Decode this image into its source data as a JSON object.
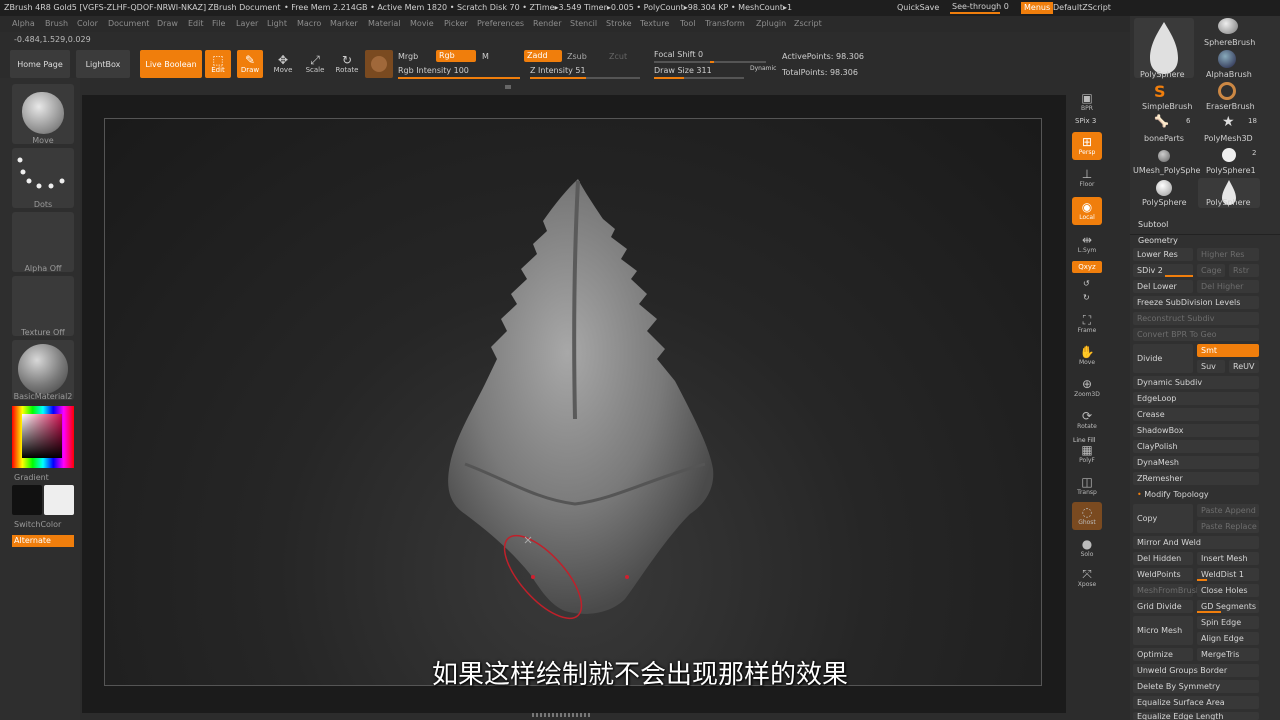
{
  "title": {
    "app": "ZBrush 4R8 Gold5 [VGFS-ZLHF-QDOF-NRWI-NKAZ]",
    "doc": "ZBrush Document",
    "stats": "• Free Mem 2.214GB • Active Mem 1820 • Scratch Disk 70 • ZTime▸3.549 Timer▸0.005 • PolyCount▸98.304 KP • MeshCount▸1",
    "quicksave": "QuickSave",
    "seethrough": "See-through 0",
    "menus": "Menus",
    "script": "DefaultZScript"
  },
  "menubar": [
    "Alpha",
    "Brush",
    "Color",
    "Document",
    "Draw",
    "Edit",
    "File",
    "Layer",
    "Light",
    "Macro",
    "Marker",
    "Material",
    "Movie",
    "Picker",
    "Preferences",
    "Render",
    "Stencil",
    "Stroke",
    "Texture",
    "Tool",
    "Transform",
    "Zplugin",
    "Zscript"
  ],
  "coords": "-0.484,1.529,0.029",
  "toolbar": {
    "home": "Home Page",
    "lightbox": "LightBox",
    "liveboolean": "Live Boolean",
    "edit": "Edit",
    "draw": "Draw",
    "move": "Move",
    "scale": "Scale",
    "rotate": "Rotate",
    "mrgb": "Mrgb",
    "rgb": "Rgb",
    "m": "M",
    "rgb_intensity": "Rgb Intensity 100",
    "zadd": "Zadd",
    "zsub": "Zsub",
    "zcut": "Zcut",
    "z_intensity": "Z Intensity 51",
    "focal_shift": "Focal Shift 0",
    "draw_size": "Draw Size 311",
    "dynamic": "Dynamic",
    "active_points": "ActivePoints: 98.306",
    "total_points": "TotalPoints: 98.306"
  },
  "left": {
    "brush": "Move",
    "stroke": "Dots",
    "alpha": "Alpha Off",
    "texture": "Texture Off",
    "material": "BasicMaterial2",
    "gradient": "Gradient",
    "switch": "SwitchColor",
    "alternate": "Alternate"
  },
  "rightshelf": [
    "BPR",
    "SPix 3",
    "Persp",
    "Floor",
    "Local",
    "L.Sym",
    "Qxyz",
    "Frame",
    "Move",
    "Zoom3D",
    "Rotate",
    "PolyF",
    "Transp",
    "Ghost",
    "Solo",
    "Xpose"
  ],
  "line_fill": "Line Fill",
  "tools": [
    {
      "name": "PolySphere",
      "n": ""
    },
    {
      "name": "SphereBrush",
      "n": ""
    },
    {
      "name": "AlphaBrush",
      "n": ""
    },
    {
      "name": "SimpleBrush",
      "n": ""
    },
    {
      "name": "EraserBrush",
      "n": ""
    },
    {
      "name": "boneParts",
      "n": "6"
    },
    {
      "name": "PolyMesh3D",
      "n": "18"
    },
    {
      "name": "UMesh_PolySphe",
      "n": ""
    },
    {
      "name": "PolySphere1",
      "n": "2"
    },
    {
      "name": "PolySphere",
      "n": ""
    },
    {
      "name": "PolySphere",
      "n": ""
    }
  ],
  "panel": {
    "subtool": "Subtool",
    "geometry": "Geometry",
    "lower_res": "Lower Res",
    "higher_res": "Higher Res",
    "sdiv": "SDiv 2",
    "cage": "Cage",
    "rstr": "Rstr",
    "del_lower": "Del Lower",
    "del_higher": "Del Higher",
    "freeze": "Freeze SubDivision Levels",
    "reconstruct": "Reconstruct Subdiv",
    "convert": "Convert BPR To Geo",
    "divide": "Divide",
    "smt": "Smt",
    "suv": "Suv",
    "reuv": "ReUV",
    "dynamic_subdiv": "Dynamic Subdiv",
    "edgeloop": "EdgeLoop",
    "crease": "Crease",
    "shadowbox": "ShadowBox",
    "claypolish": "ClayPolish",
    "dynamesh": "DynaMesh",
    "zremesher": "ZRemesher",
    "modify_topology": "Modify Topology",
    "copy": "Copy",
    "paste_append": "Paste Append",
    "paste_replace": "Paste Replace",
    "mirror_weld": "Mirror And Weld",
    "del_hidden": "Del Hidden",
    "insert_mesh": "Insert Mesh",
    "weld_points": "WeldPoints",
    "welddist": "WeldDist 1",
    "mesh_from_brush": "MeshFromBrush",
    "close_holes": "Close Holes",
    "grid_divide": "Grid Divide",
    "gd_segments": "GD Segments 3",
    "spin_edge": "Spin Edge",
    "align_edge": "Align Edge",
    "micro_mesh": "Micro Mesh",
    "optimize_points": "Optimize Points",
    "merge_tris": "MergeTris",
    "unweld_groups": "Unweld Groups Border",
    "delete_symmetry": "Delete By Symmetry",
    "equalize_area": "Equalize Surface Area",
    "equalize_edge": "Equalize Edge Length"
  },
  "subtitle": "如果这样绘制就不会出现那样的效果",
  "colors": {
    "accent": "#f07e0c",
    "bg": "#2c2c2c",
    "viewport": "#1b1b1b"
  }
}
